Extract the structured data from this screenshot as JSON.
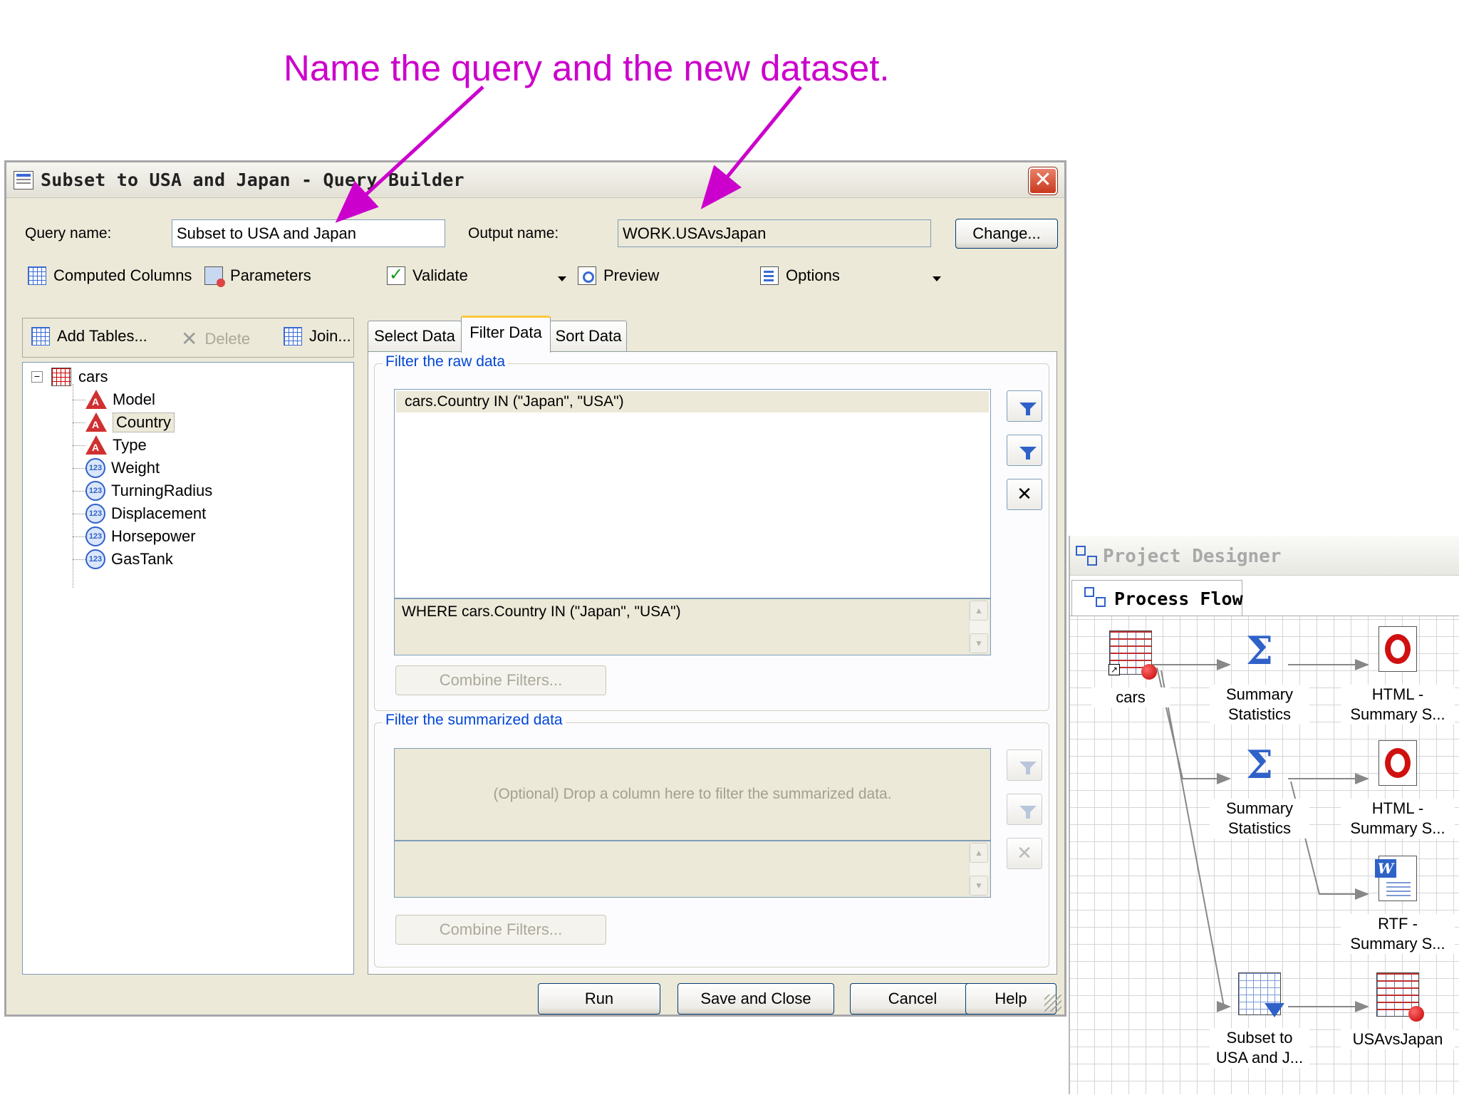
{
  "annotation": {
    "text": "Name the query and the new dataset."
  },
  "dialog": {
    "title": "Subset to USA and Japan - Query Builder",
    "close_label": "✕",
    "query_name_label": "Query name:",
    "query_name_value": "Subset to USA and Japan",
    "output_name_label": "Output name:",
    "output_name_value": "WORK.USAvsJapan",
    "change_label": "Change...",
    "toolbar": {
      "computed_columns": "Computed Columns",
      "parameters": "Parameters",
      "validate": "Validate",
      "preview": "Preview",
      "options": "Options"
    },
    "tables": {
      "add_tables": "Add Tables...",
      "delete": "Delete",
      "join": "Join...",
      "root": "cars",
      "columns": [
        {
          "name": "Model",
          "type": "char"
        },
        {
          "name": "Country",
          "type": "char"
        },
        {
          "name": "Type",
          "type": "char"
        },
        {
          "name": "Weight",
          "type": "num"
        },
        {
          "name": "TurningRadius",
          "type": "num"
        },
        {
          "name": "Displacement",
          "type": "num"
        },
        {
          "name": "Horsepower",
          "type": "num"
        },
        {
          "name": "GasTank",
          "type": "num"
        }
      ],
      "num_icon_text": "123",
      "expander": "−"
    },
    "tabs": [
      "Select Data",
      "Filter Data",
      "Sort Data"
    ],
    "active_tab": "Filter Data",
    "raw_filter": {
      "group_title": "Filter the raw data",
      "filters": [
        "cars.Country IN (\"Japan\", \"USA\")"
      ],
      "where_clause": "WHERE cars.Country IN (\"Japan\", \"USA\")",
      "combine_label": "Combine Filters..."
    },
    "summarized_filter": {
      "group_title": "Filter the summarized data",
      "placeholder": "(Optional) Drop a column here to filter the summarized data.",
      "combine_label": "Combine Filters..."
    },
    "delete_symbol": "✕",
    "buttons": {
      "run": "Run",
      "save_close": "Save and Close",
      "cancel": "Cancel",
      "help": "Help"
    }
  },
  "project_designer": {
    "title": "Project Designer",
    "tab": "Process Flow",
    "nodes": {
      "cars": "cars",
      "summary1": [
        "Summary",
        "Statistics"
      ],
      "summary2": [
        "Summary",
        "Statistics"
      ],
      "html1": [
        "HTML -",
        "Summary S..."
      ],
      "html2": [
        "HTML -",
        "Summary S..."
      ],
      "rtf": [
        "RTF -",
        "Summary S..."
      ],
      "subset": [
        "Subset to",
        "USA and J..."
      ],
      "usavsjapan": "USAvsJapan"
    },
    "sigma": "Σ",
    "word_icon_text": "W",
    "shortcut_glyph": "↗"
  },
  "colors": {
    "annotation": "#cc00cc",
    "group_title": "#0046d5",
    "close_button": "#c8391d"
  }
}
